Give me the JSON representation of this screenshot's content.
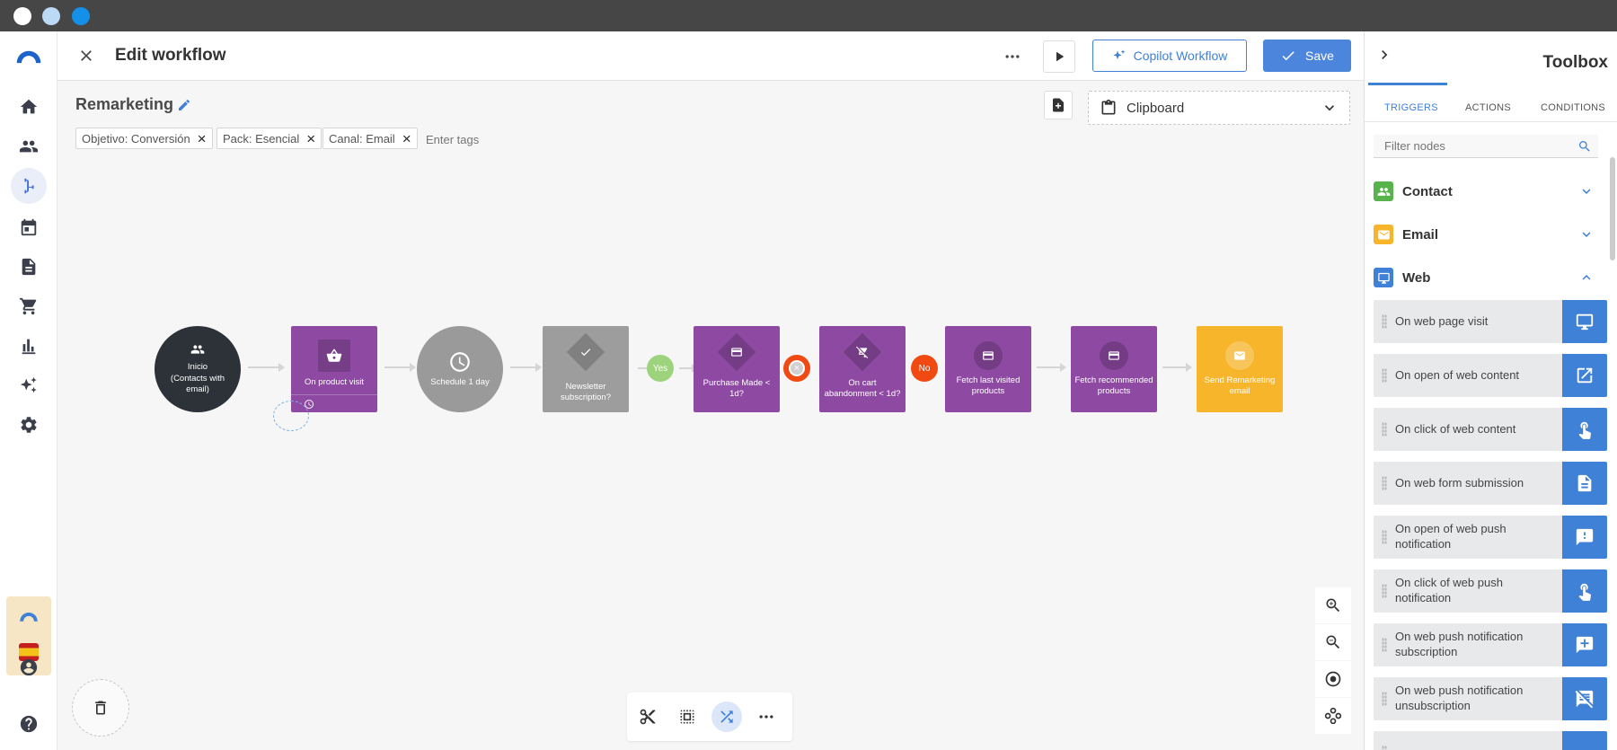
{
  "header": {
    "title": "Edit workflow",
    "copilot_label": "Copilot Workflow",
    "save_label": "Save"
  },
  "workflow": {
    "name": "Remarketing",
    "tags": [
      "Objetivo: Conversión",
      "Pack: Esencial",
      "Canal: Email"
    ],
    "tags_placeholder": "Enter tags",
    "clipboard_label": "Clipboard"
  },
  "nodes": {
    "inicio": "Inicio (Contacts with email)",
    "product_visit": "On product visit",
    "schedule": "Schedule 1 day",
    "newsletter": "Newsletter subscription?",
    "purchase": "Purchase Made < 1d?",
    "cart": "On cart abandonment < 1d?",
    "fetch_last": "Fetch last visited products",
    "fetch_recommended": "Fetch recommended products",
    "send_email": "Send Remarketing email"
  },
  "badges": {
    "yes": "Yes",
    "no": "No"
  },
  "toolbox": {
    "title": "Toolbox",
    "tabs": [
      "TRIGGERS",
      "ACTIONS",
      "CONDITIONS"
    ],
    "active_tab": "TRIGGERS",
    "filter_placeholder": "Filter nodes",
    "categories": [
      "Contact",
      "Email",
      "Web"
    ],
    "web_items": [
      "On web page visit",
      "On open of web content",
      "On click of web content",
      "On web form submission",
      "On open of web push notification",
      "On click of web push notification",
      "On web push notification subscription",
      "On web push notification unsubscription"
    ]
  },
  "colors": {
    "accent": "#3f81d6",
    "purple_node": "#8e4aa3",
    "grey_node": "#9a9a9a",
    "dark_node": "#2d3239",
    "email_node": "#f7b52c",
    "yes_badge": "#9ed37d",
    "no_badge": "#f04a12"
  }
}
